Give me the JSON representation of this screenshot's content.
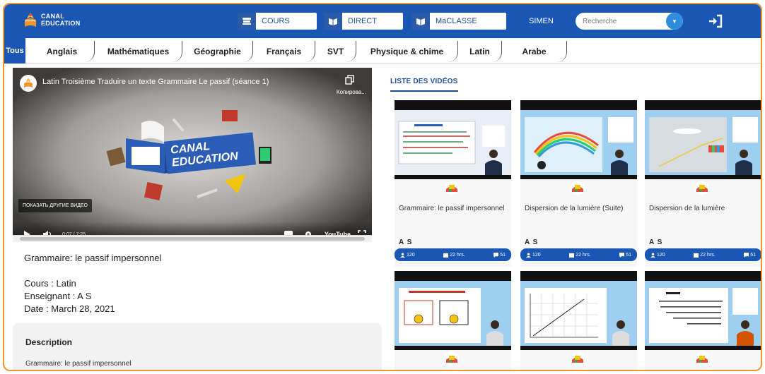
{
  "header": {
    "logo_line1": "CANAL",
    "logo_line2": "EDUCATION",
    "buttons": [
      {
        "label": "COURS",
        "icon": "book-stack-icon"
      },
      {
        "label": "DIRECT",
        "icon": "open-book-icon"
      },
      {
        "label": "MaCLASSE",
        "icon": "open-book-icon"
      }
    ],
    "user": "SIMEN",
    "search_placeholder": "Recherche",
    "logout_icon": "logout-icon"
  },
  "tabs": [
    "Tous",
    "Anglais",
    "Mathématiques",
    "Géographie",
    "Français",
    "SVT",
    "Physique & chime",
    "Latin",
    "Arabe"
  ],
  "video": {
    "title": "Latin Troisième Traduire un texte Grammaire Le passif (séance 1)",
    "copy_label": "Копирова...",
    "other_videos": "ПОКАЗАТЬ ДРУГИЕ ВИДЕО",
    "brand_line1": "CANAL",
    "brand_line2": "EDUCATION",
    "time": "0:07 / 7:25",
    "player_brand": "YouTube"
  },
  "info": {
    "title": "Grammaire: le passif impersonnel",
    "course": "Cours : Latin",
    "teacher": "Enseignant : A S",
    "date": "Date : March 28, 2021"
  },
  "description": {
    "heading": "Description",
    "text": "Grammaire: le passif impersonnel"
  },
  "list": {
    "title": "LISTE DES VIDÉOS",
    "cards": [
      {
        "title": "Grammaire: le passif impersonnel",
        "author": "A S",
        "views": "120",
        "date": "22 ‎hrs.",
        "comments": "51"
      },
      {
        "title": "Dispersion de la lumière (Suite)",
        "author": "A S",
        "views": "120",
        "date": "22 ‎hrs.",
        "comments": "51"
      },
      {
        "title": "Dispersion de la lumière",
        "author": "A S",
        "views": "120",
        "date": "22 ‎hrs.",
        "comments": "51"
      },
      {
        "title": "",
        "author": "",
        "views": "",
        "date": "",
        "comments": ""
      },
      {
        "title": "",
        "author": "",
        "views": "",
        "date": "",
        "comments": ""
      },
      {
        "title": "",
        "author": "",
        "views": "",
        "date": "",
        "comments": ""
      }
    ]
  },
  "colors": {
    "primary_blue": "#1a56b4",
    "frame_orange": "#f0962e",
    "accent_light_blue": "#2f8de0"
  }
}
